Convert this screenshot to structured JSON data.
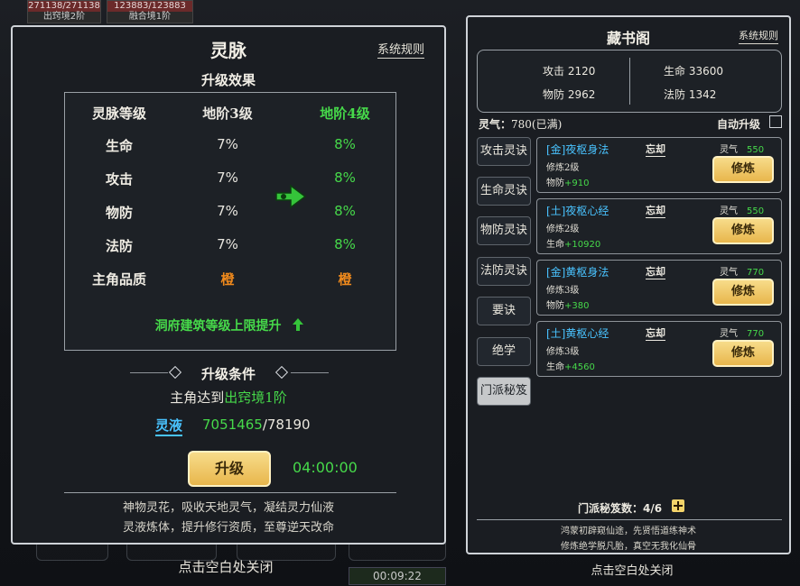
{
  "top_badges": [
    {
      "bar": "271138/271138",
      "label": "出窍境2阶"
    },
    {
      "bar": "123883/123883",
      "label": "融合境1阶"
    }
  ],
  "left": {
    "title": "灵脉",
    "rules": "系统规则",
    "subtitle": "升级效果",
    "header": {
      "label": "灵脉等级",
      "current": "地阶3级",
      "next": "地阶4级"
    },
    "rows": [
      {
        "label": "生命",
        "current": "7%",
        "next": "8%"
      },
      {
        "label": "攻击",
        "current": "7%",
        "next": "8%"
      },
      {
        "label": "物防",
        "current": "7%",
        "next": "8%"
      },
      {
        "label": "法防",
        "current": "7%",
        "next": "8%"
      },
      {
        "label": "主角品质",
        "current": "橙",
        "next": "橙"
      }
    ],
    "unlock_text": "洞府建筑等级上限提升",
    "cond_title": "升级条件",
    "cond_prefix": "主角达到",
    "cond_target": "出窍境1阶",
    "resource_label": "灵液",
    "resource_have": "7051465",
    "resource_need": "/78190",
    "upgrade_btn": "升级",
    "timer": "04:00:00",
    "flavor1": "神物灵花，吸收天地灵气，凝结灵力仙液",
    "flavor2": "灵液炼体，提升修行资质，至尊逆天改命",
    "close_hint": "点击空白处关闭",
    "bottom_timer": "00:09:22"
  },
  "right": {
    "title": "藏书阁",
    "rules": "系统规则",
    "stats": {
      "atk_label": "攻击",
      "atk": "2120",
      "hp_label": "生命",
      "hp": "33600",
      "pdef_label": "物防",
      "pdef": "2962",
      "mdef_label": "法防",
      "mdef": "1342"
    },
    "lingqi_label": "灵气：",
    "lingqi_value": "780(已满)",
    "auto_label": "自动升级",
    "tabs": [
      "攻击灵诀",
      "生命灵诀",
      "物防灵诀",
      "法防灵诀",
      "要诀",
      "绝学",
      "门派秘笈"
    ],
    "cards": [
      {
        "name": "[金]夜枢身法",
        "forget": "忘却",
        "level": "修炼2级",
        "eff_label": "物防",
        "eff_val": "+910",
        "cost_label": "灵气",
        "cost": "550",
        "btn": "修炼"
      },
      {
        "name": "[土]夜枢心经",
        "forget": "忘却",
        "level": "修炼2级",
        "eff_label": "生命",
        "eff_val": "+10920",
        "cost_label": "灵气",
        "cost": "550",
        "btn": "修炼"
      },
      {
        "name": "[金]黄枢身法",
        "forget": "忘却",
        "level": "修炼3级",
        "eff_label": "物防",
        "eff_val": "+380",
        "cost_label": "灵气",
        "cost": "770",
        "btn": "修炼"
      },
      {
        "name": "[土]黄枢心经",
        "forget": "忘却",
        "level": "修炼3级",
        "eff_label": "生命",
        "eff_val": "+4560",
        "cost_label": "灵气",
        "cost": "770",
        "btn": "修炼"
      }
    ],
    "secret_label": "门派秘笈数：",
    "secret_value": "4/6",
    "flavor1": "鸿蒙初辟窥仙途，先贤悟道练神术",
    "flavor2": "修炼绝学脱凡胎，真空无我化仙骨",
    "close_hint": "点击空白处关闭"
  },
  "colors": {
    "green": "#46d94a",
    "blue": "#49c3ff",
    "orange": "#f08a1c",
    "gold": "#e8b64c"
  }
}
